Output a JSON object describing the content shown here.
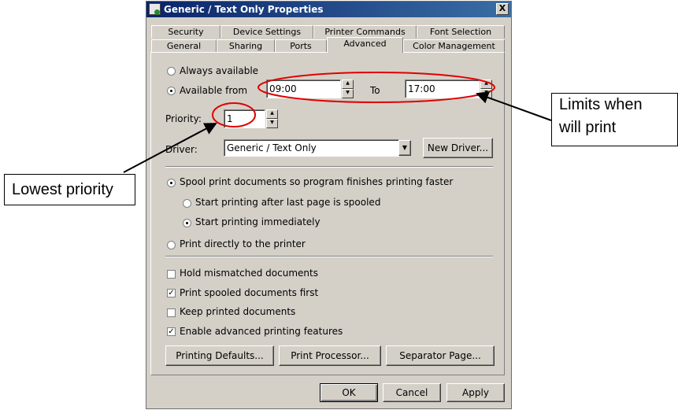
{
  "window": {
    "title": "Generic / Text Only Properties",
    "close_glyph": "X"
  },
  "tabs_row1": [
    "Security",
    "Device Settings",
    "Printer Commands",
    "Font Selection"
  ],
  "tabs_row2": [
    "General",
    "Sharing",
    "Ports",
    "Advanced",
    "Color Management"
  ],
  "availability": {
    "always_label": "Always available",
    "from_label": "Available from",
    "from_value": "09:00",
    "to_label": "To",
    "to_value": "17:00"
  },
  "priority": {
    "label": "Priority:",
    "value": "1"
  },
  "driver": {
    "label": "Driver:",
    "value": "Generic / Text Only",
    "new_button": "New Driver..."
  },
  "spool": {
    "spool_label": "Spool print documents so program finishes printing faster",
    "after_last_label": "Start printing after last page is spooled",
    "immediately_label": "Start printing immediately",
    "direct_label": "Print directly to the printer"
  },
  "options": {
    "hold_mismatched": "Hold mismatched documents",
    "spooled_first": "Print spooled documents first",
    "keep_printed": "Keep printed documents",
    "advanced_features": "Enable advanced printing features",
    "check_glyph": "✓"
  },
  "bottom_buttons": {
    "defaults": "Printing Defaults...",
    "processor": "Print Processor...",
    "separator": "Separator Page..."
  },
  "dialog_buttons": {
    "ok": "OK",
    "cancel": "Cancel",
    "apply": "Apply"
  },
  "annotations": {
    "limits_line1": "Limits when",
    "limits_line2": "will print",
    "lowest": "Lowest priority",
    "highlight_color": "#e00000"
  }
}
